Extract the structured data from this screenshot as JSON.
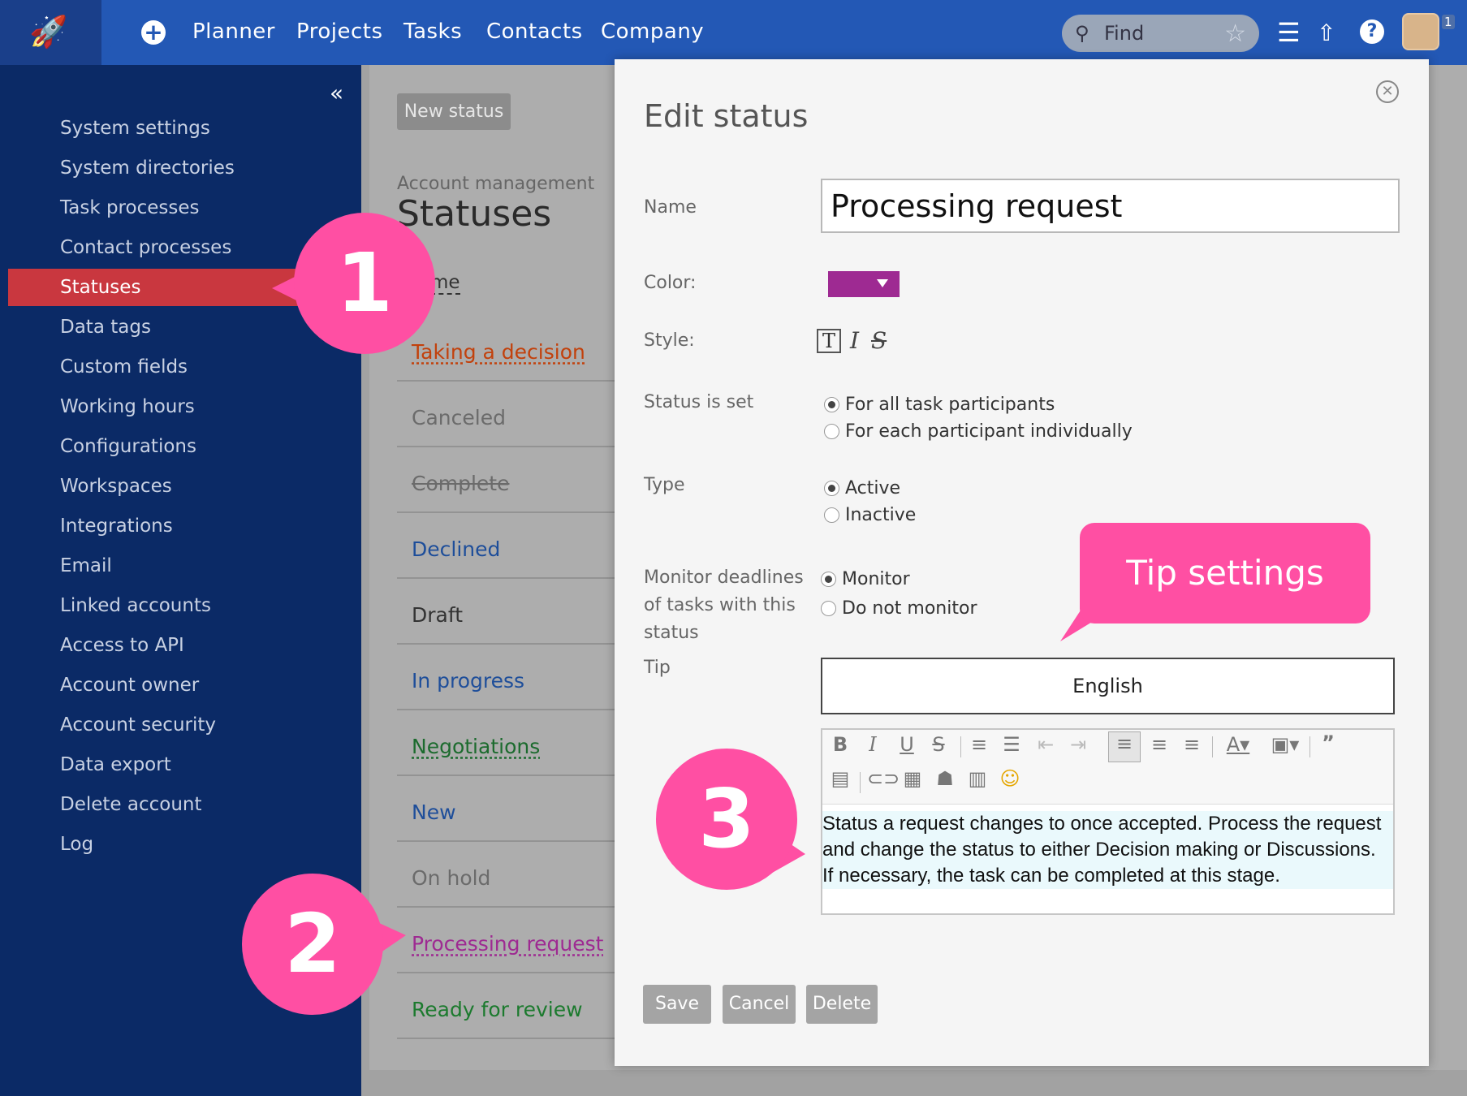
{
  "topbar": {
    "nav": [
      "Planner",
      "Projects",
      "Tasks",
      "Contacts",
      "Company"
    ],
    "search_placeholder": "Find",
    "avatar_badge": "1"
  },
  "sidebar": {
    "items": [
      {
        "label": "System settings"
      },
      {
        "label": "System directories"
      },
      {
        "label": "Task processes"
      },
      {
        "label": "Contact processes"
      },
      {
        "label": "Statuses",
        "active": true
      },
      {
        "label": "Data tags"
      },
      {
        "label": "Custom fields"
      },
      {
        "label": "Working hours"
      },
      {
        "label": "Configurations"
      },
      {
        "label": "Workspaces"
      },
      {
        "label": "Integrations"
      },
      {
        "label": "Email"
      },
      {
        "label": "Linked accounts"
      },
      {
        "label": "Access to API"
      },
      {
        "label": "Account owner"
      },
      {
        "label": "Account security"
      },
      {
        "label": "Data export"
      },
      {
        "label": "Delete account"
      },
      {
        "label": "Log"
      }
    ]
  },
  "main": {
    "new_status_label": "New status",
    "breadcrumb": "Account management",
    "title": "Statuses",
    "column_header": "me",
    "statuses": [
      {
        "label": "Taking a decision",
        "color": "#c2410c",
        "underline": "dotted"
      },
      {
        "label": "Canceled",
        "color": "#6b6b6b"
      },
      {
        "label": "Complete",
        "color": "#6b6b6b",
        "strike": true
      },
      {
        "label": "Declined",
        "color": "#1e4e9a"
      },
      {
        "label": "Draft",
        "color": "#333333"
      },
      {
        "label": "In progress",
        "color": "#1e4e9a"
      },
      {
        "label": "Negotiations",
        "color": "#1c6b2e",
        "underline": "dotted"
      },
      {
        "label": "New",
        "color": "#1e4e9a"
      },
      {
        "label": "On hold",
        "color": "#6b6b6b"
      },
      {
        "label": "Processing request",
        "color": "#9e2a92",
        "underline": "dotted"
      },
      {
        "label": "Ready for review",
        "color": "#1c7a2e"
      }
    ]
  },
  "modal": {
    "title": "Edit status",
    "name_label": "Name",
    "name_value": "Processing request",
    "color_label": "Color:",
    "color_value": "#9e2a92",
    "style_label": "Style:",
    "status_set_label": "Status is set",
    "status_set_options": [
      "For all task participants",
      "For each participant individually"
    ],
    "type_label": "Type",
    "type_options": [
      "Active",
      "Inactive"
    ],
    "monitor_label_lines": [
      "Monitor deadlines",
      "of tasks with this",
      "status"
    ],
    "monitor_options": [
      "Monitor",
      "Do not monitor"
    ],
    "tip_label": "Tip",
    "language": "English",
    "tip_lines": [
      "Status a request changes to once accepted. Process the request",
      "and change the status to either Decision making or Discussions.",
      "If necessary, the task can be completed at this stage."
    ],
    "buttons": {
      "save": "Save",
      "cancel": "Cancel",
      "delete": "Delete"
    }
  },
  "callouts": {
    "one": "1",
    "two": "2",
    "three": "3",
    "tip_settings": "Tip settings"
  }
}
